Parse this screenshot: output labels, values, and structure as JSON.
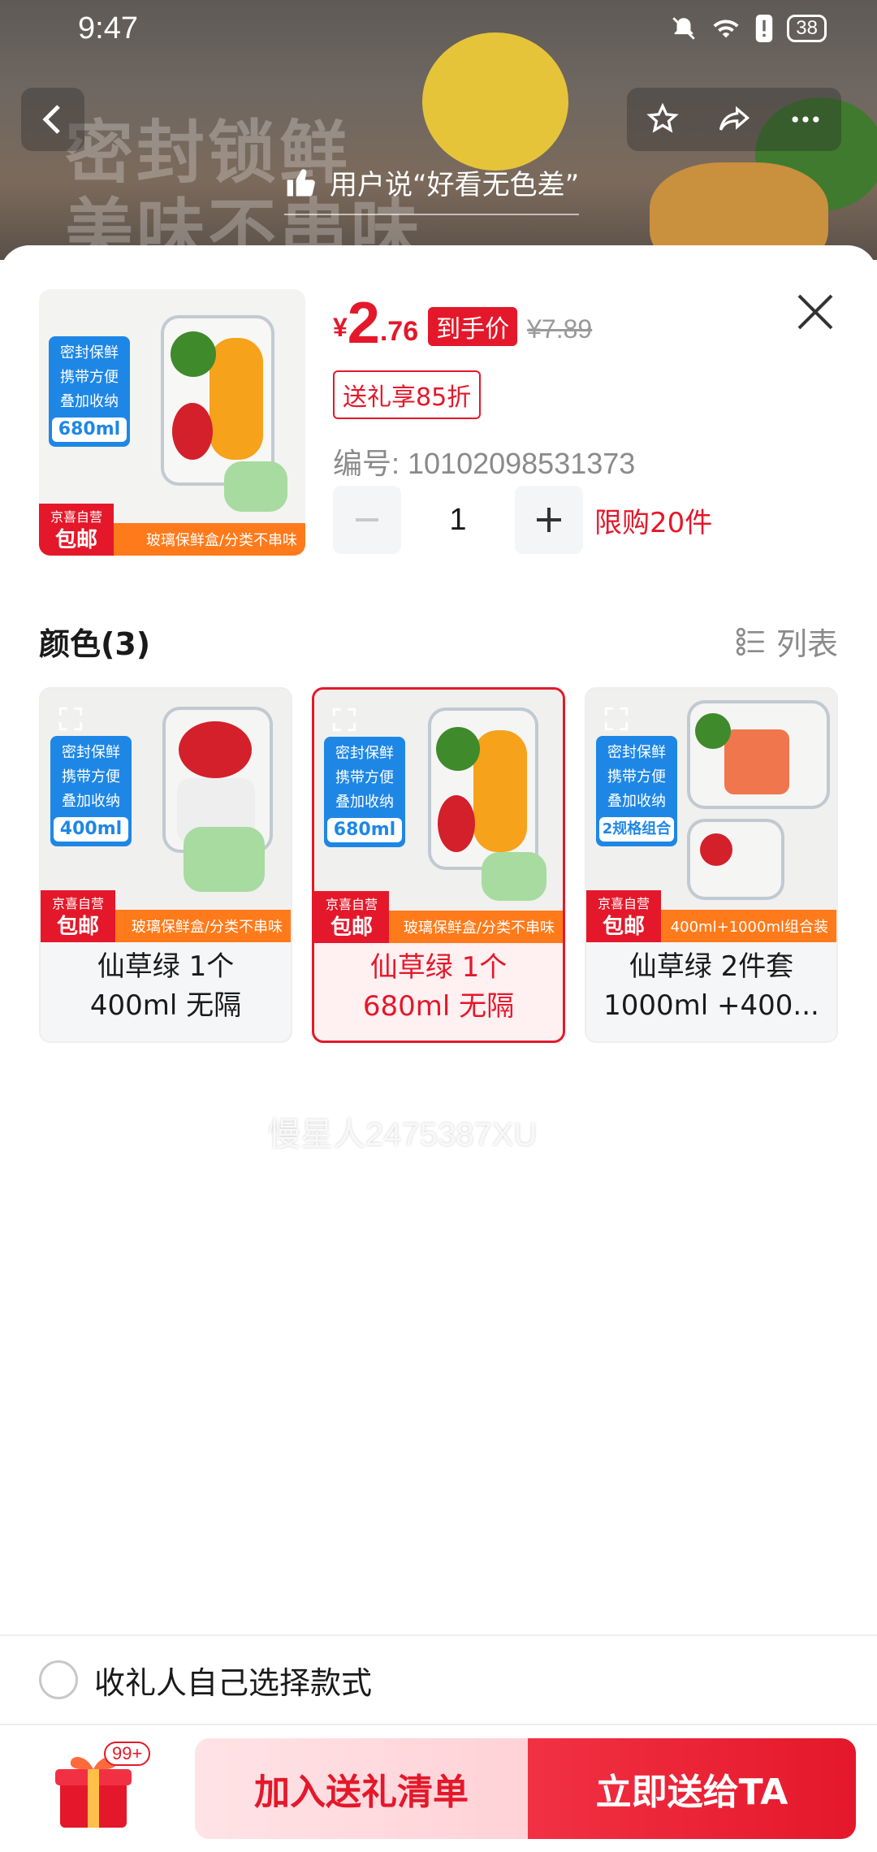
{
  "status_bar": {
    "time": "9:47",
    "battery": "38"
  },
  "banner": {
    "bg_text_line1": "密封锁鲜",
    "bg_text_line2": "美味不串味",
    "quote": "用户说“好看无色差”"
  },
  "product": {
    "currency": "¥",
    "price_int": "2",
    "price_dec": ".76",
    "price_tag": "到手价",
    "old_price": "¥7.89",
    "coupon": "送礼享85折",
    "sku": "编号: 10102098531373",
    "qty": "1",
    "limit": "限购20件"
  },
  "thumb": {
    "badges": [
      "密封保鲜",
      "携带方便",
      "叠加收纳"
    ],
    "volume": "680ml",
    "jd_line1": "京喜自营",
    "jd_line2": "包邮",
    "bar_text": "玻璃保鲜盒/分类不串味"
  },
  "section": {
    "title": "颜色(3)",
    "list_label": "列表"
  },
  "options": [
    {
      "badges": [
        "密封保鲜",
        "携带方便",
        "叠加收纳"
      ],
      "volume": "400ml",
      "jd_line1": "京喜自营",
      "jd_line2": "包邮",
      "bar_text": "玻璃保鲜盒/分类不串味",
      "line1": "仙草绿 1个",
      "line2": "400ml 无隔"
    },
    {
      "badges": [
        "密封保鲜",
        "携带方便",
        "叠加收纳"
      ],
      "volume": "680ml",
      "jd_line1": "京喜自营",
      "jd_line2": "包邮",
      "bar_text": "玻璃保鲜盒/分类不串味",
      "line1": "仙草绿 1个",
      "line2": "680ml 无隔"
    },
    {
      "badges": [
        "密封保鲜",
        "携带方便",
        "叠加收纳"
      ],
      "volume": "2规格组合",
      "jd_line1": "京喜自营",
      "jd_line2": "包邮",
      "bar_text": "400ml+1000ml组合装",
      "line1": "仙草绿 2件套",
      "line2": "1000ml +400..."
    }
  ],
  "watermark": "慢星人2475387XU",
  "gift_option": "收礼人自己选择款式",
  "bottom": {
    "badge": "99+",
    "add_label": "加入送礼清单",
    "send_label": "立即送给TA"
  },
  "colors": {
    "accent": "#e4182a",
    "orange": "#ff7a1a",
    "badge_blue": "#1e87e6"
  }
}
